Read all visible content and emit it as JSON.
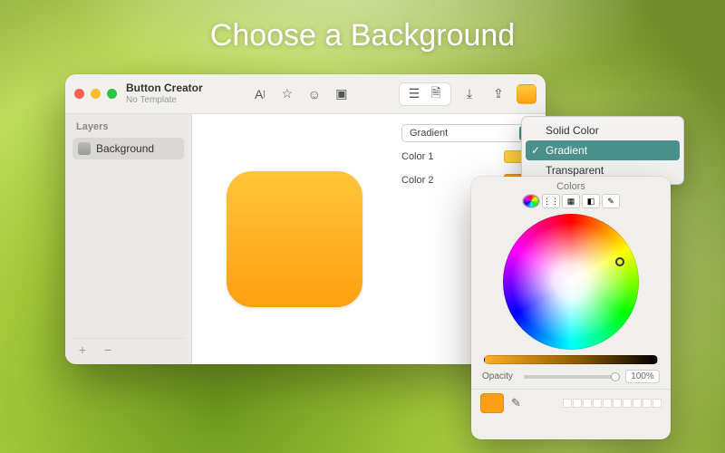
{
  "hero": "Choose a Background",
  "main_window": {
    "title": "Button Creator",
    "subtitle": "No Template",
    "toolbar_icons": {
      "text": "text-style-icon",
      "star": "favorite-icon",
      "emoji": "emoji-icon",
      "image": "image-icon",
      "layers": "layers-icon",
      "doc": "document-icon",
      "export": "export-icon",
      "share": "share-icon"
    },
    "sidebar": {
      "heading": "Layers",
      "items": [
        {
          "label": "Background"
        }
      ],
      "add_label": "+",
      "remove_label": "−"
    },
    "properties": {
      "fill_type_label": "Gradient",
      "color1_label": "Color 1",
      "color2_label": "Color 2",
      "colors": {
        "c1": "#ffcf3f",
        "c2": "#ff9f15"
      }
    }
  },
  "fill_menu": {
    "options": [
      "Solid Color",
      "Gradient",
      "Transparent"
    ],
    "selected": "Gradient"
  },
  "color_picker": {
    "title": "Colors",
    "tabs": [
      "wheel",
      "sliders",
      "palettes",
      "image",
      "pencils"
    ],
    "opacity_label": "Opacity",
    "opacity_value": "100%",
    "current_color": "#ff9f15"
  }
}
